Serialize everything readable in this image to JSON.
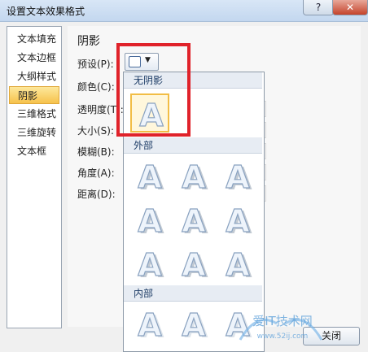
{
  "window": {
    "title": "设置文本效果格式",
    "help_label": "?",
    "close_label": "✕"
  },
  "sidebar": {
    "items": [
      {
        "label": "文本填充"
      },
      {
        "label": "文本边框"
      },
      {
        "label": "大纲样式"
      },
      {
        "label": "阴影",
        "selected": true
      },
      {
        "label": "三维格式"
      },
      {
        "label": "三维旋转"
      },
      {
        "label": "文本框"
      }
    ]
  },
  "panel": {
    "title": "阴影",
    "rows": [
      {
        "label": "预设(P):"
      },
      {
        "label": "颜色(C):"
      },
      {
        "label": "透明度(T):"
      },
      {
        "label": "大小(S):"
      },
      {
        "label": "模糊(B):"
      },
      {
        "label": "角度(A):"
      },
      {
        "label": "距离(D):"
      }
    ]
  },
  "gallery": {
    "categories": [
      {
        "label": "无阴影"
      },
      {
        "label": "外部"
      },
      {
        "label": "内部"
      }
    ],
    "tile_letter": "A"
  },
  "footer": {
    "close_button": "关闭"
  },
  "watermark": {
    "text": "爱IT技术网",
    "url": "www.52ij.com"
  },
  "colors": {
    "selection": "#f6c24c",
    "highlight_box": "#e0222a",
    "header_bg": "#e7ecf3"
  }
}
